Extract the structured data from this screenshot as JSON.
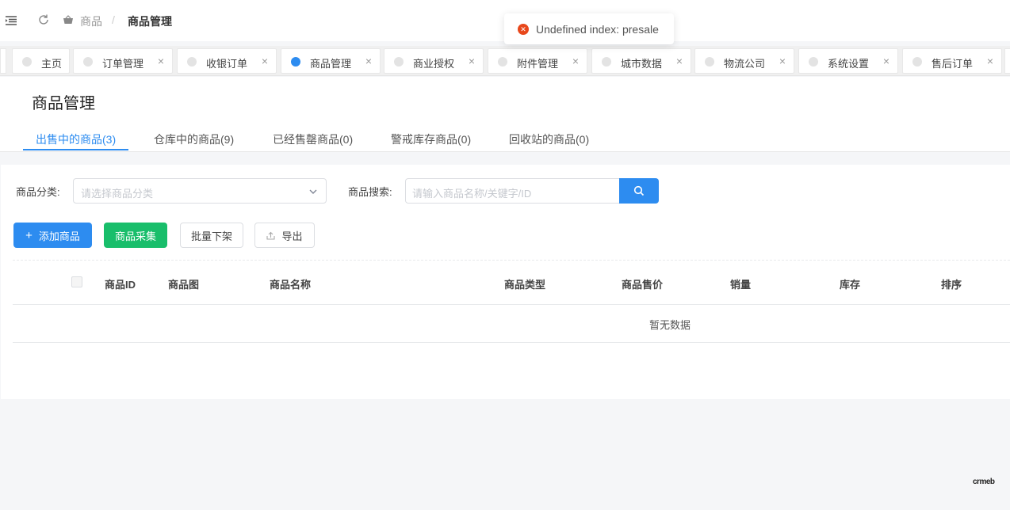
{
  "header": {
    "breadcrumb": [
      "商品",
      "商品管理"
    ],
    "breadcrumb_sep": "/"
  },
  "toast": {
    "message": "Undefined index: presale",
    "icon": "error-circle-icon",
    "color": "#e8471b"
  },
  "tabs": [
    {
      "label": "主页",
      "closable": false,
      "active": false
    },
    {
      "label": "订单管理",
      "closable": true,
      "active": false
    },
    {
      "label": "收银订单",
      "closable": true,
      "active": false
    },
    {
      "label": "商品管理",
      "closable": true,
      "active": true
    },
    {
      "label": "商业授权",
      "closable": true,
      "active": false
    },
    {
      "label": "附件管理",
      "closable": true,
      "active": false
    },
    {
      "label": "城市数据",
      "closable": true,
      "active": false
    },
    {
      "label": "物流公司",
      "closable": true,
      "active": false
    },
    {
      "label": "系统设置",
      "closable": true,
      "active": false
    },
    {
      "label": "售后订单",
      "closable": true,
      "active": false
    }
  ],
  "page": {
    "title": "商品管理",
    "subtabs": [
      {
        "label": "出售中的商品(3)",
        "active": true
      },
      {
        "label": "仓库中的商品(9)",
        "active": false
      },
      {
        "label": "已经售罄商品(0)",
        "active": false
      },
      {
        "label": "警戒库存商品(0)",
        "active": false
      },
      {
        "label": "回收站的商品(0)",
        "active": false
      }
    ]
  },
  "filters": {
    "category_label": "商品分类:",
    "category_placeholder": "请选择商品分类",
    "search_label": "商品搜索:",
    "search_placeholder": "请输入商品名称/关键字/ID"
  },
  "actions": {
    "add": "添加商品",
    "collect": "商品采集",
    "batch_off": "批量下架",
    "export": "导出"
  },
  "table": {
    "columns": [
      "商品ID",
      "商品图",
      "商品名称",
      "商品类型",
      "商品售价",
      "销量",
      "库存",
      "排序"
    ],
    "empty_text": "暂无数据"
  },
  "brand": "crmeb",
  "colors": {
    "primary": "#2d8cf0",
    "success": "#19be6b"
  }
}
